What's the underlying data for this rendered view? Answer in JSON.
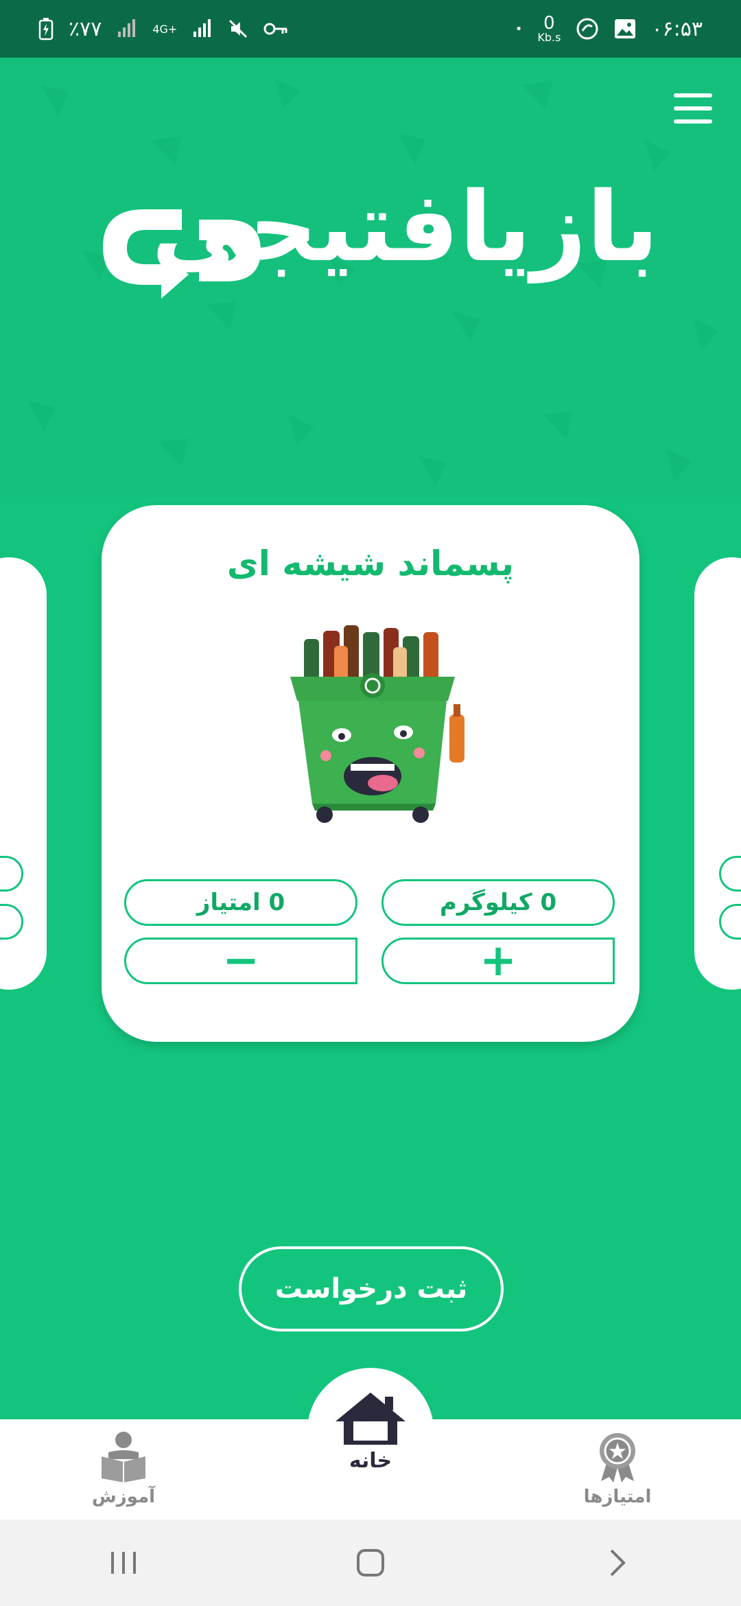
{
  "status_bar": {
    "time": "۰۶:۵۳",
    "net_speed_value": "0",
    "net_speed_unit": "Kb.s",
    "battery": "٪۷۷",
    "network_type": "4G+"
  },
  "header": {
    "logo_text": "بازیافتیجی"
  },
  "card": {
    "title": "پسماند شیشه ای",
    "weight_label": "0 کیلوگرم",
    "points_label": "0 امتیاز",
    "plus_label": "+",
    "minus_label": "−"
  },
  "submit": {
    "label": "ثبت درخواست"
  },
  "bottom_nav": {
    "home_label": "خانه",
    "learn_label": "آموزش",
    "points_label": "امتیازها"
  },
  "colors": {
    "primary": "#13c47d",
    "status_bar": "#0c6b47",
    "card": "#ffffff"
  },
  "icons": {
    "home": "home-icon",
    "learn": "reading-person-icon",
    "points": "award-badge-icon",
    "menu": "hamburger-menu-icon"
  }
}
